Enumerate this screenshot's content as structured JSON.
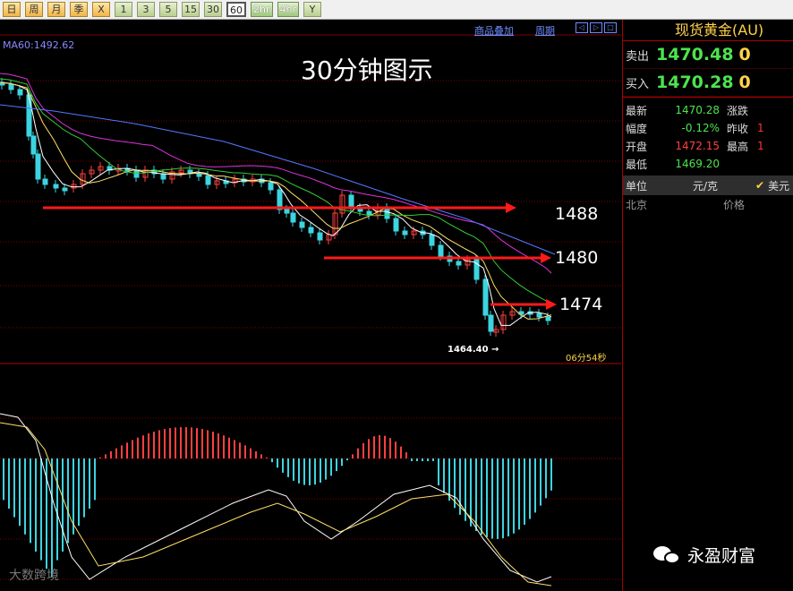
{
  "toolbar": {
    "buttons": [
      {
        "label": "日",
        "style": "orange"
      },
      {
        "label": "周",
        "style": "orange"
      },
      {
        "label": "月",
        "style": "orange"
      },
      {
        "label": "季",
        "style": "orange"
      },
      {
        "label": "X",
        "style": "orange"
      },
      {
        "label": "1",
        "style": ""
      },
      {
        "label": "3",
        "style": ""
      },
      {
        "label": "5",
        "style": ""
      },
      {
        "label": "15",
        "style": ""
      },
      {
        "label": "30",
        "style": ""
      },
      {
        "label": "60",
        "style": "sel"
      },
      {
        "label": "2hr",
        "style": "green"
      },
      {
        "label": "4hr",
        "style": "green"
      },
      {
        "label": "Y",
        "style": ""
      }
    ]
  },
  "chart": {
    "links": {
      "overlay": "商品叠加",
      "period": "周期"
    },
    "ma_label": "MA60:1492.62",
    "title": "30分钟图示",
    "levels": [
      "1488",
      "1480",
      "1474"
    ],
    "low_label": "1464.40",
    "timer": "06分54秒",
    "colors": {
      "up": "#ff4040",
      "down": "#3cd4e0",
      "ma_white": "#ffffff",
      "ma_yellow": "#ffe066",
      "ma_green": "#33cc33",
      "ma_magenta": "#dd33dd",
      "ma_blue": "#5577ff",
      "arrow": "#ff1a1a",
      "grid": "#7a0000"
    }
  },
  "panel": {
    "title": "现货黄金(AU)",
    "sell": {
      "label": "卖出",
      "price": "1470.48",
      "vol": "0"
    },
    "buy": {
      "label": "买入",
      "price": "1470.28",
      "vol": "0"
    },
    "stats": [
      {
        "k": "最新",
        "v": "1470.28",
        "vc": "green",
        "k2": "涨跌",
        "v2": ""
      },
      {
        "k": "幅度",
        "v": "-0.12%",
        "vc": "green",
        "k2": "昨收",
        "v2": "1"
      },
      {
        "k": "开盘",
        "v": "1472.15",
        "vc": "red",
        "k2": "最高",
        "v2": "1"
      },
      {
        "k": "最低",
        "v": "1469.20",
        "vc": "green",
        "k2": "",
        "v2": ""
      }
    ],
    "unit": {
      "label": "单位",
      "value": "元/克",
      "check": "✔",
      "currency": "美元"
    },
    "header": {
      "location": "北京",
      "price": "价格"
    }
  },
  "watermark": {
    "text": "永盈财富",
    "logo": "大数跨境"
  }
}
